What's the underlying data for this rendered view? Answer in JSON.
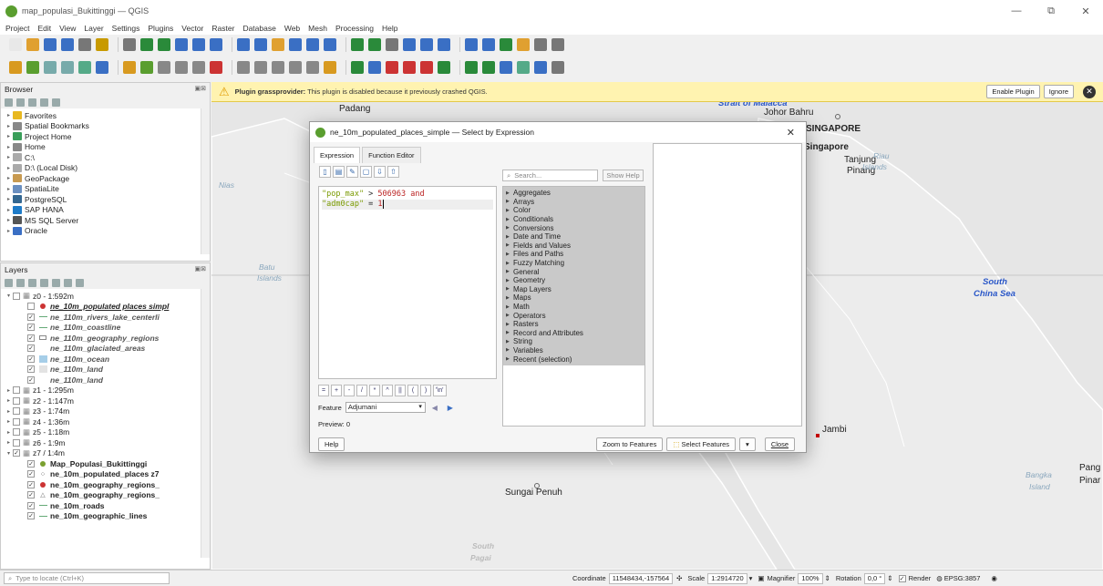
{
  "window": {
    "title": "map_populasi_Bukittinggi — QGIS",
    "controls": [
      "—",
      "⧉",
      "✕"
    ]
  },
  "menu": [
    "Project",
    "Edit",
    "View",
    "Layer",
    "Settings",
    "Plugins",
    "Vector",
    "Raster",
    "Database",
    "Web",
    "Mesh",
    "Processing",
    "Help"
  ],
  "browser": {
    "title": "Browser",
    "items": [
      {
        "label": "Favorites",
        "icon": "star-icon",
        "expanded": false,
        "indent": 0
      },
      {
        "label": "Spatial Bookmarks",
        "icon": "bookmark-icon",
        "indent": 0
      },
      {
        "label": "Project Home",
        "icon": "project-home-icon",
        "indent": 0
      },
      {
        "label": "Home",
        "icon": "home-folder-icon",
        "indent": 0
      },
      {
        "label": "C:\\",
        "icon": "drive-icon",
        "indent": 0
      },
      {
        "label": "D:\\ (Local Disk)",
        "icon": "drive-icon",
        "indent": 0
      },
      {
        "label": "GeoPackage",
        "icon": "geopackage-icon",
        "indent": 0
      },
      {
        "label": "SpatiaLite",
        "icon": "spatialite-icon",
        "indent": 0
      },
      {
        "label": "PostgreSQL",
        "icon": "postgresql-icon",
        "indent": 0
      },
      {
        "label": "SAP HANA",
        "icon": "sap-hana-icon",
        "indent": 0
      },
      {
        "label": "MS SQL Server",
        "icon": "mssql-icon",
        "indent": 0
      },
      {
        "label": "Oracle",
        "icon": "oracle-icon",
        "indent": 0
      }
    ]
  },
  "layers": {
    "title": "Layers",
    "items": [
      {
        "label": "z0 - 1:592m",
        "group": true,
        "checked": false,
        "expanded": true,
        "indent": 0
      },
      {
        "label": "ne_10m_populated places simpl",
        "checked": false,
        "style": "bold-italic-underline",
        "indent": 1,
        "icon": "point-red-icon"
      },
      {
        "label": "ne_110m_rivers_lake_centerli",
        "checked": true,
        "style": "italic-b",
        "indent": 1,
        "icon": "line-icon"
      },
      {
        "label": "ne_110m_coastline",
        "checked": true,
        "style": "italic-b",
        "indent": 1,
        "icon": "line-icon"
      },
      {
        "label": "ne_110m_geography_regions",
        "checked": true,
        "style": "italic-b",
        "indent": 1,
        "icon": "polygon-outline-icon"
      },
      {
        "label": "ne_110m_glaciated_areas",
        "checked": true,
        "style": "italic-b",
        "indent": 1,
        "icon": "none"
      },
      {
        "label": "ne_110m_ocean",
        "checked": true,
        "style": "italic-b",
        "indent": 1,
        "icon": "ocean-fill-icon"
      },
      {
        "label": "ne_110m_land",
        "checked": true,
        "style": "italic-b",
        "indent": 1,
        "icon": "land-fill-icon"
      },
      {
        "label": "ne_110m_land",
        "checked": true,
        "style": "italic-b",
        "indent": 1,
        "icon": "none"
      },
      {
        "label": "z1 - 1:295m",
        "group": true,
        "checked": false,
        "indent": 0
      },
      {
        "label": "z2 - 1:147m",
        "group": true,
        "checked": false,
        "indent": 0
      },
      {
        "label": "z3 - 1:74m",
        "group": true,
        "checked": false,
        "indent": 0
      },
      {
        "label": "z4 - 1:36m",
        "group": true,
        "checked": false,
        "indent": 0
      },
      {
        "label": "z5 - 1:18m",
        "group": true,
        "checked": false,
        "indent": 0
      },
      {
        "label": "z6 - 1:9m",
        "group": true,
        "checked": false,
        "indent": 0
      },
      {
        "label": "z7 / 1:4m",
        "group": true,
        "checked": true,
        "expanded": true,
        "indent": 0
      },
      {
        "label": "Map_Populasi_Bukittinggi",
        "checked": true,
        "style": "bold",
        "indent": 1,
        "icon": "point-green-icon"
      },
      {
        "label": "ne_10m_populated_places z7",
        "checked": true,
        "style": "bold",
        "indent": 1,
        "icon": "points-icon"
      },
      {
        "label": "ne_10m_geography_regions_",
        "checked": true,
        "style": "bold",
        "indent": 1,
        "icon": "point-red-icon"
      },
      {
        "label": "ne_10m_geography_regions_",
        "checked": true,
        "style": "bold",
        "indent": 1,
        "icon": "triangle-icon"
      },
      {
        "label": "ne_10m_roads",
        "checked": true,
        "style": "bold",
        "indent": 1,
        "icon": "line-icon"
      },
      {
        "label": "ne_10m_geographic_lines",
        "checked": true,
        "style": "bold",
        "indent": 1,
        "icon": "line-icon"
      }
    ]
  },
  "plugin_bar": {
    "bold": "Plugin grassprovider:",
    "message": " This plugin is disabled because it previously crashed QGIS.",
    "enable_label": "Enable Plugin",
    "ignore_label": "Ignore"
  },
  "map_labels": [
    {
      "text": "Padang",
      "cls": ""
    },
    {
      "text": "Strait of Malacca",
      "cls": "sea"
    },
    {
      "text": "Johor Bahru",
      "cls": ""
    },
    {
      "text": "SINGAPORE",
      "cls": "bold"
    },
    {
      "text": "Singapore",
      "cls": "bold"
    },
    {
      "text": "Tanjung",
      "cls": ""
    },
    {
      "text": "Pinang",
      "cls": ""
    },
    {
      "text": "Riau",
      "cls": "isle"
    },
    {
      "text": "Islands",
      "cls": "isle"
    },
    {
      "text": "Nias",
      "cls": "isle"
    },
    {
      "text": "Batu",
      "cls": "isle"
    },
    {
      "text": "Islands",
      "cls": "isle"
    },
    {
      "text": "South",
      "cls": "sea"
    },
    {
      "text": "China Sea",
      "cls": "sea"
    },
    {
      "text": "Jambi",
      "cls": ""
    },
    {
      "text": "Sungai Penuh",
      "cls": ""
    },
    {
      "text": "South",
      "cls": "sea2"
    },
    {
      "text": "Pagai",
      "cls": "sea2"
    },
    {
      "text": "Bangka",
      "cls": "isle"
    },
    {
      "text": "Island",
      "cls": "isle"
    },
    {
      "text": "Pang",
      "cls": ""
    },
    {
      "text": "Pinar",
      "cls": ""
    }
  ],
  "dialog": {
    "title": "ne_10m_populated_places_simple — Select by Expression",
    "tabs": [
      "Expression",
      "Function Editor"
    ],
    "expression_lines": [
      [
        {
          "t": "\"pop_max\"",
          "c": "str"
        },
        {
          "t": " > ",
          "c": ""
        },
        {
          "t": "506963",
          "c": "kw"
        },
        {
          "t": " and",
          "c": "kw"
        }
      ],
      [
        {
          "t": "\"adm0cap\"",
          "c": "str"
        },
        {
          "t": " = ",
          "c": ""
        },
        {
          "t": "1",
          "c": "kw"
        }
      ]
    ],
    "operators": [
      "=",
      "+",
      "-",
      "/",
      "*",
      "^",
      "||",
      "(",
      ")",
      "'\\n'"
    ],
    "feature_label": "Feature",
    "feature_value": "Adjumani",
    "preview": "Preview: 0",
    "search_placeholder": "Search...",
    "show_help": "Show Help",
    "functions": [
      "Aggregates",
      "Arrays",
      "Color",
      "Conditionals",
      "Conversions",
      "Date and Time",
      "Fields and Values",
      "Files and Paths",
      "Fuzzy Matching",
      "General",
      "Geometry",
      "Map Layers",
      "Maps",
      "Math",
      "Operators",
      "Rasters",
      "Record and Attributes",
      "String",
      "Variables",
      "Recent (selection)"
    ],
    "help_label": "Help",
    "zoom_label": "Zoom to Features",
    "select_label": "Select Features",
    "close_label": "Close"
  },
  "status": {
    "locate_placeholder": "Type to locate (Ctrl+K)",
    "coordinate_label": "Coordinate",
    "coordinate_value": "11548434,-157564",
    "scale_label": "Scale",
    "scale_value": "1:2914720",
    "magnifier_label": "Magnifier",
    "magnifier_value": "100%",
    "rotation_label": "Rotation",
    "rotation_value": "0,0 °",
    "render_label": "Render",
    "crs_label": "EPSG:3857"
  },
  "colors": {
    "accent": "#5a9e2f",
    "warning_bg": "#fff3b0",
    "sea_label": "#2a57c8",
    "land": "#e9e9e9"
  }
}
